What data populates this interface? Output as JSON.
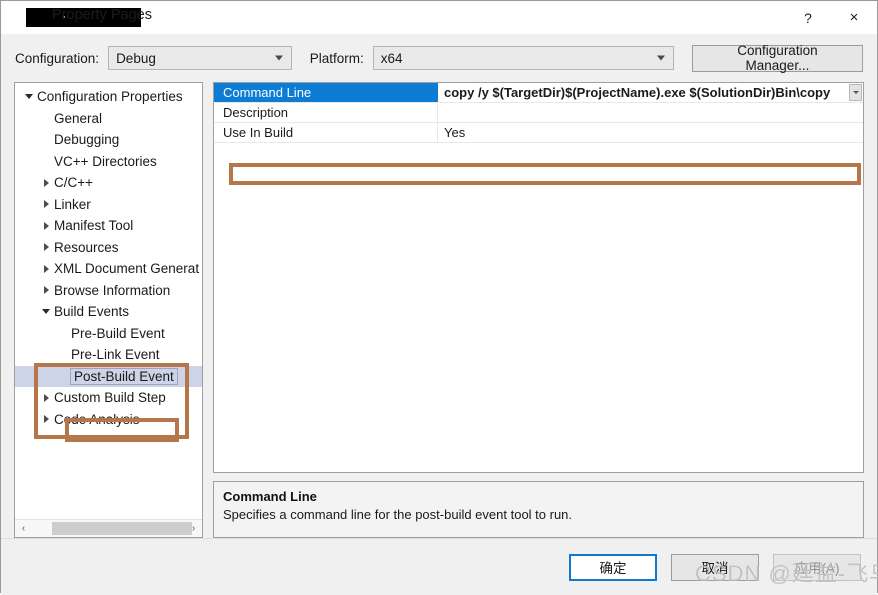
{
  "window": {
    "title": "Property Pages",
    "title_redacted": true,
    "help_button": "?",
    "close_button": "×"
  },
  "toolbar": {
    "configuration_label": "Configuration:",
    "configuration_value": "Debug",
    "platform_label": "Platform:",
    "platform_value": "x64",
    "configuration_manager_label": "Configuration Manager..."
  },
  "tree": {
    "items": [
      {
        "label": "Configuration Properties",
        "indent": 0,
        "twisty": "expanded",
        "selected": false
      },
      {
        "label": "General",
        "indent": 1,
        "twisty": "none",
        "selected": false
      },
      {
        "label": "Debugging",
        "indent": 1,
        "twisty": "none",
        "selected": false
      },
      {
        "label": "VC++ Directories",
        "indent": 1,
        "twisty": "none",
        "selected": false
      },
      {
        "label": "C/C++",
        "indent": 1,
        "twisty": "collapsed",
        "selected": false
      },
      {
        "label": "Linker",
        "indent": 1,
        "twisty": "collapsed",
        "selected": false
      },
      {
        "label": "Manifest Tool",
        "indent": 1,
        "twisty": "collapsed",
        "selected": false
      },
      {
        "label": "Resources",
        "indent": 1,
        "twisty": "collapsed",
        "selected": false
      },
      {
        "label": "XML Document Generat",
        "indent": 1,
        "twisty": "collapsed",
        "selected": false
      },
      {
        "label": "Browse Information",
        "indent": 1,
        "twisty": "collapsed",
        "selected": false
      },
      {
        "label": "Build Events",
        "indent": 1,
        "twisty": "expanded",
        "selected": false
      },
      {
        "label": "Pre-Build Event",
        "indent": 2,
        "twisty": "none",
        "selected": false
      },
      {
        "label": "Pre-Link Event",
        "indent": 2,
        "twisty": "none",
        "selected": false
      },
      {
        "label": "Post-Build Event",
        "indent": 2,
        "twisty": "none",
        "selected": true
      },
      {
        "label": "Custom Build Step",
        "indent": 1,
        "twisty": "collapsed",
        "selected": false
      },
      {
        "label": "Code Analysis",
        "indent": 1,
        "twisty": "collapsed",
        "selected": false
      }
    ],
    "scrollbar": {
      "left_arrow": "‹",
      "right_arrow": "›"
    }
  },
  "propgrid": {
    "rows": [
      {
        "name": "Command Line",
        "value": "copy /y $(TargetDir)$(ProjectName).exe $(SolutionDir)Bin\\copy",
        "selected": true,
        "has_dropdown": true
      },
      {
        "name": "Description",
        "value": "",
        "selected": false,
        "has_dropdown": false
      },
      {
        "name": "Use In Build",
        "value": "Yes",
        "selected": false,
        "has_dropdown": false
      }
    ]
  },
  "description_pane": {
    "title": "Command Line",
    "text": "Specifies a command line for the post-build event tool to run."
  },
  "footer": {
    "ok_label": "确定",
    "cancel_label": "取消",
    "apply_label": "应用(A)"
  },
  "watermark": {
    "text": "CSDN @廷益-飞鸟"
  },
  "colors": {
    "selection_blue": "#0c7cd5",
    "tree_selection": "#cdd4e8",
    "annotation_orange": "#b5764a",
    "default_button_border": "#1177d1"
  }
}
